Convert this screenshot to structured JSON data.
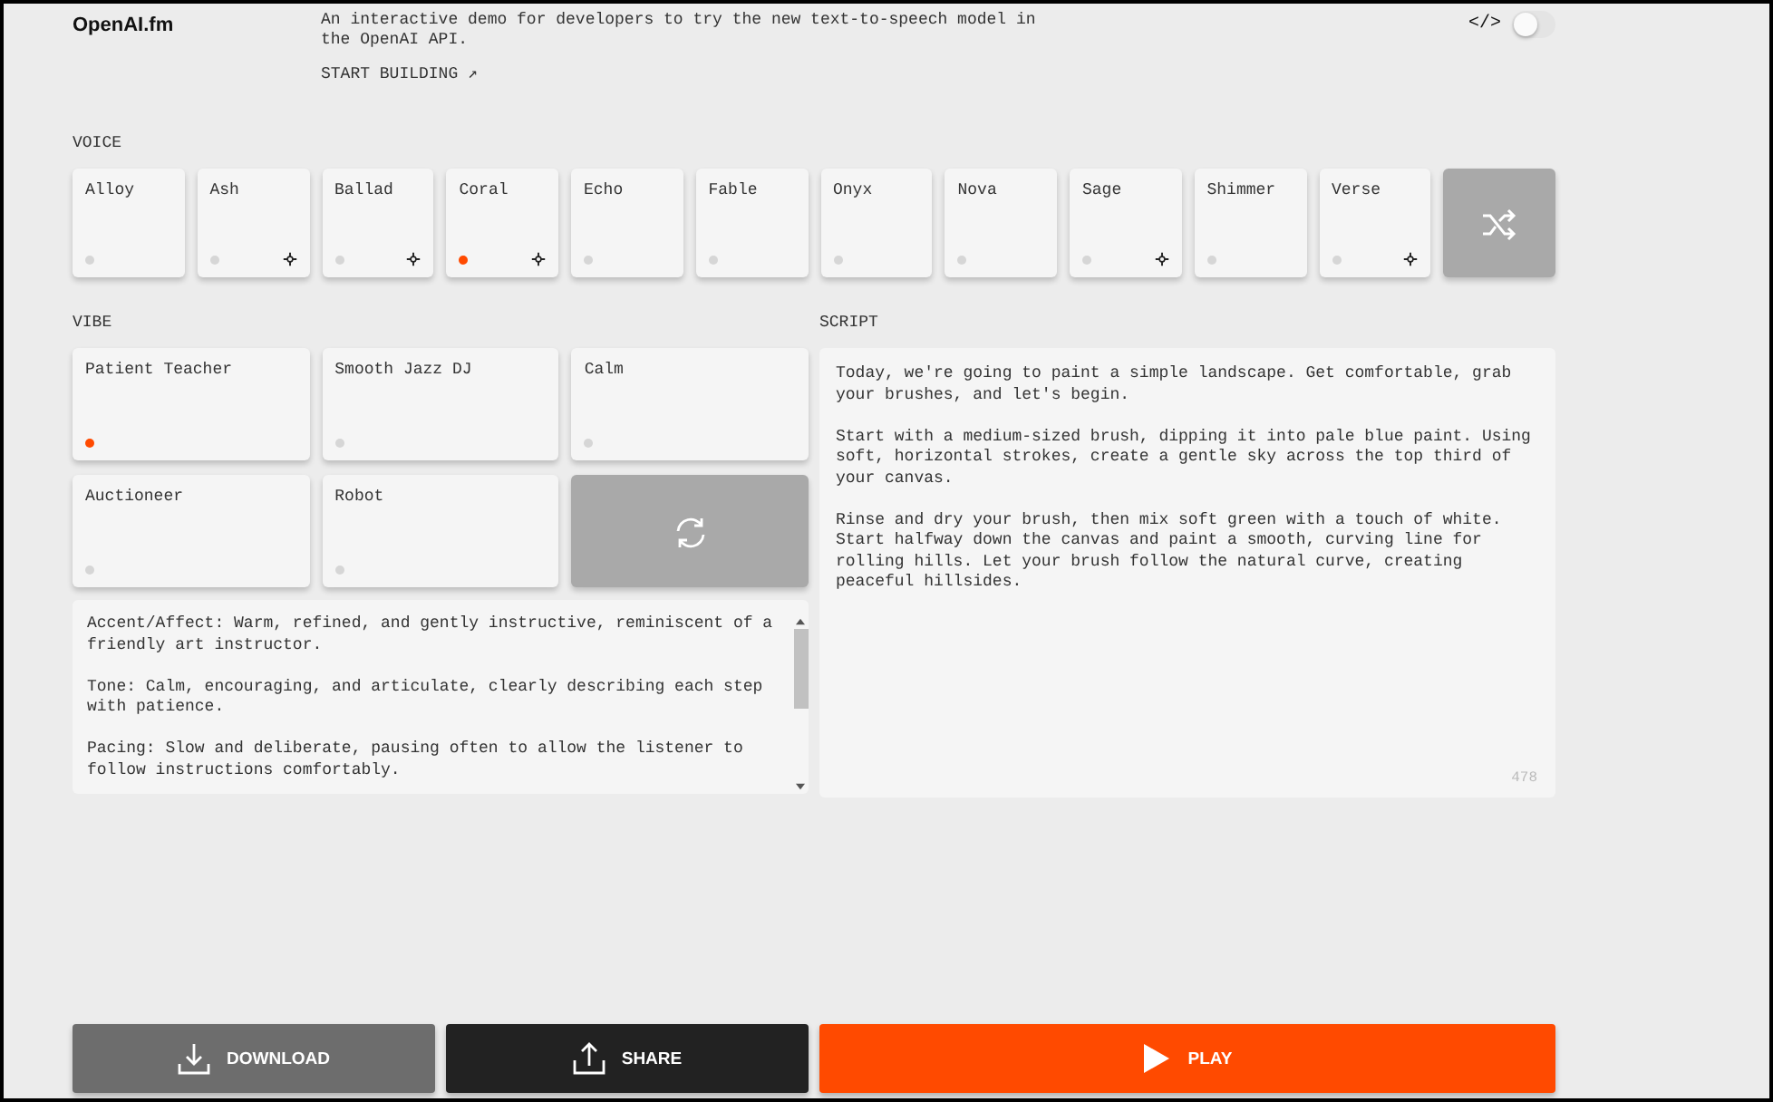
{
  "header": {
    "logo": "OpenAI.fm",
    "description": "An interactive demo for developers to try the new text-to-speech model in the OpenAI API.",
    "link": "START BUILDING ↗",
    "code_icon": "</>",
    "toggle": {
      "on": false
    }
  },
  "voice": {
    "label": "VOICE",
    "items": [
      {
        "name": "Alloy",
        "selected": false,
        "starred": false
      },
      {
        "name": "Ash",
        "selected": false,
        "starred": true
      },
      {
        "name": "Ballad",
        "selected": false,
        "starred": true
      },
      {
        "name": "Coral",
        "selected": true,
        "starred": true
      },
      {
        "name": "Echo",
        "selected": false,
        "starred": false
      },
      {
        "name": "Fable",
        "selected": false,
        "starred": false
      },
      {
        "name": "Onyx",
        "selected": false,
        "starred": false
      },
      {
        "name": "Nova",
        "selected": false,
        "starred": false
      },
      {
        "name": "Sage",
        "selected": false,
        "starred": true
      },
      {
        "name": "Shimmer",
        "selected": false,
        "starred": false
      },
      {
        "name": "Verse",
        "selected": false,
        "starred": true
      }
    ]
  },
  "vibe": {
    "label": "VIBE",
    "items": [
      {
        "name": "Patient Teacher",
        "selected": true
      },
      {
        "name": "Smooth Jazz DJ",
        "selected": false
      },
      {
        "name": "Calm",
        "selected": false
      },
      {
        "name": "Auctioneer",
        "selected": false
      },
      {
        "name": "Robot",
        "selected": false
      }
    ],
    "instructions": "Accent/Affect: Warm, refined, and gently instructive, reminiscent of a friendly art instructor.\n\nTone: Calm, encouraging, and articulate, clearly describing each step with patience.\n\nPacing: Slow and deliberate, pausing often to allow the listener to follow instructions comfortably."
  },
  "script": {
    "label": "SCRIPT",
    "text": "Today, we're going to paint a simple landscape. Get comfortable, grab your brushes, and let's begin.\n\nStart with a medium-sized brush, dipping it into pale blue paint. Using soft, horizontal strokes, create a gentle sky across the top third of your canvas.\n\nRinse and dry your brush, then mix soft green with a touch of white. Start halfway down the canvas and paint a smooth, curving line for rolling hills. Let your brush follow the natural curve, creating peaceful hillsides.",
    "count": "478"
  },
  "actions": [
    {
      "kind": "download",
      "label": "DOWNLOAD"
    },
    {
      "kind": "share",
      "label": "SHARE"
    },
    {
      "kind": "play",
      "label": "PLAY"
    }
  ]
}
